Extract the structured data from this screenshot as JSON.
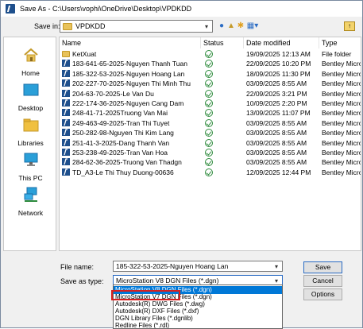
{
  "window": {
    "title": "Save As - C:\\Users\\vophi\\OneDrive\\Desktop\\VPDKDD"
  },
  "savein": {
    "label": "Save in:",
    "value": "VPDKDD"
  },
  "toolbar_icons": [
    "back-icon",
    "up-folder-icon",
    "new-folder-icon",
    "view-menu-icon",
    "browse-icon"
  ],
  "places": [
    {
      "label": "Home",
      "icon": "home-icon"
    },
    {
      "label": "Desktop",
      "icon": "desktop-icon"
    },
    {
      "label": "Libraries",
      "icon": "libraries-icon"
    },
    {
      "label": "This PC",
      "icon": "this-pc-icon"
    },
    {
      "label": "Network",
      "icon": "network-icon"
    }
  ],
  "columns": {
    "name": "Name",
    "status": "Status",
    "date": "Date modified",
    "type": "Type"
  },
  "files": [
    {
      "name": "KetXuat",
      "date": "19/09/2025 12:13 AM",
      "type": "File folder",
      "kind": "folder"
    },
    {
      "name": "183-641-65-2025-Nguyen Thanh Tuan",
      "date": "22/09/2025 10:20 PM",
      "type": "Bentley MicroStation",
      "kind": "dgn"
    },
    {
      "name": "185-322-53-2025-Nguyen Hoang Lan",
      "date": "18/09/2025 11:30 PM",
      "type": "Bentley MicroStation",
      "kind": "dgn"
    },
    {
      "name": "202-227-70-2025-Nguyen Thi Minh Thu",
      "date": "03/09/2025 8:55 AM",
      "type": "Bentley MicroStation",
      "kind": "dgn"
    },
    {
      "name": "204-63-70-2025-Le Van Du",
      "date": "22/09/2025 3:21 PM",
      "type": "Bentley MicroStation",
      "kind": "dgn"
    },
    {
      "name": "222-174-36-2025-Nguyen Cang Dam",
      "date": "10/09/2025 2:20 PM",
      "type": "Bentley MicroStation",
      "kind": "dgn"
    },
    {
      "name": "248-41-71-2025Truong Van Mai",
      "date": "13/09/2025 11:07 PM",
      "type": "Bentley MicroStation",
      "kind": "dgn"
    },
    {
      "name": "249-463-49-2025-Tran Thi Tuyet",
      "date": "03/09/2025 8:55 AM",
      "type": "Bentley MicroStation",
      "kind": "dgn"
    },
    {
      "name": "250-282-98-Nguyen Thi Kim Lang",
      "date": "03/09/2025 8:55 AM",
      "type": "Bentley MicroStation",
      "kind": "dgn"
    },
    {
      "name": "251-41-3-2025-Dang Thanh Van",
      "date": "03/09/2025 8:55 AM",
      "type": "Bentley MicroStation",
      "kind": "dgn"
    },
    {
      "name": "253-238-49-2025-Tran Van Hoa",
      "date": "03/09/2025 8:55 AM",
      "type": "Bentley MicroStation",
      "kind": "dgn"
    },
    {
      "name": "284-62-36-2025-Truong Van Thadgn",
      "date": "03/09/2025 8:55 AM",
      "type": "Bentley MicroStation",
      "kind": "dgn"
    },
    {
      "name": "TD_A3-Le Thi Thuy Duong-00636",
      "date": "12/09/2025 12:44 PM",
      "type": "Bentley MicroStation",
      "kind": "dgn"
    }
  ],
  "filename": {
    "label": "File name:",
    "value": "185-322-53-2025-Nguyen Hoang Lan"
  },
  "savetype": {
    "label": "Save as type:",
    "value": "MicroStation V8 DGN Files (*.dgn)",
    "options": [
      "MicroStation V8 DGN Files (*.dgn)",
      "MicroStation V7 DGN Files (*.dgn)",
      "Autodesk(R) DWG Files (*.dwg)",
      "Autodesk(R) DXF Files (*.dxf)",
      "DGN Library Files (*.dgnlib)",
      "Redline Files (*.rdl)"
    ],
    "highlighted_index": 0
  },
  "buttons": {
    "save": "Save",
    "cancel": "Cancel",
    "options": "Options"
  },
  "colors": {
    "accent": "#0078d7",
    "annotation_box": "#d62020",
    "status_ok": "#2e8b3d"
  }
}
